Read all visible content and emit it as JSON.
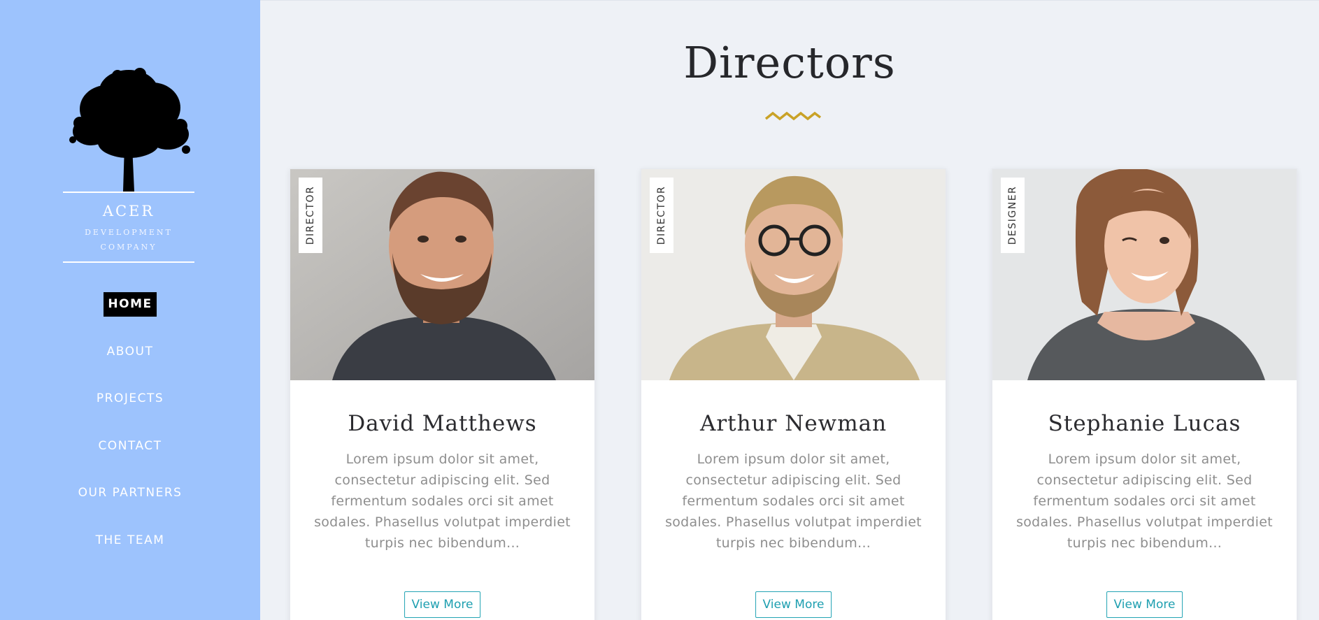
{
  "brand": {
    "name": "ACER",
    "tagline": "DEVELOPMENT COMPANY",
    "logo_icon": "tree-icon"
  },
  "nav": {
    "items": [
      {
        "label": "HOME",
        "active": true
      },
      {
        "label": "ABOUT",
        "active": false
      },
      {
        "label": "PROJECTS",
        "active": false
      },
      {
        "label": "CONTACT",
        "active": false
      },
      {
        "label": "OUR PARTNERS",
        "active": false
      },
      {
        "label": "THE TEAM",
        "active": false
      }
    ]
  },
  "main": {
    "title": "Directors"
  },
  "cards": [
    {
      "tag": "DIRECTOR",
      "name": "David Matthews",
      "bio": "Lorem ipsum dolor sit amet, consectetur adipiscing elit. Sed fermentum sodales orci sit amet sodales. Phasellus volutpat imperdiet turpis nec bibendum...",
      "button": "View More"
    },
    {
      "tag": "DIRECTOR",
      "name": "Arthur Newman",
      "bio": "Lorem ipsum dolor sit amet, consectetur adipiscing elit. Sed fermentum sodales orci sit amet sodales. Phasellus volutpat imperdiet turpis nec bibendum...",
      "button": "View More"
    },
    {
      "tag": "DESIGNER",
      "name": "Stephanie Lucas",
      "bio": "Lorem ipsum dolor sit amet, consectetur adipiscing elit. Sed fermentum sodales orci sit amet sodales. Phasellus volutpat imperdiet turpis nec bibendum...",
      "button": "View More"
    }
  ],
  "colors": {
    "sidebar": "#9dc3fd",
    "background": "#eef1f6",
    "accent": "#c9a227",
    "button": "#1e9fb0",
    "active_nav": "#000000"
  }
}
